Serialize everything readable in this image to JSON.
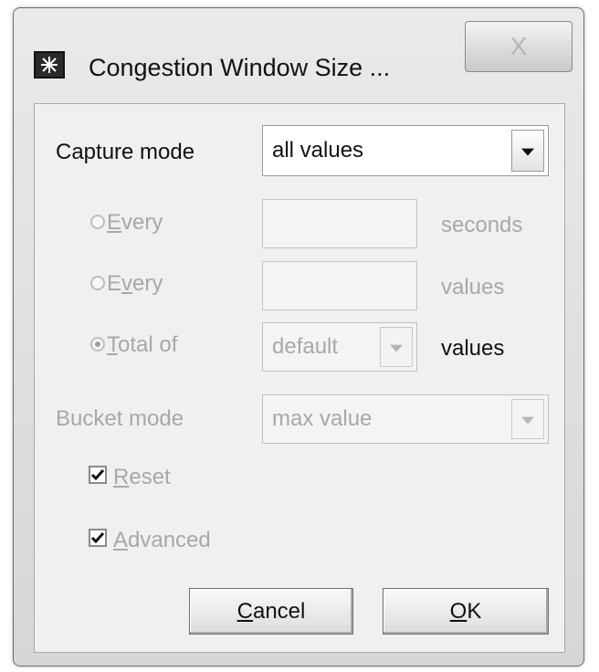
{
  "window": {
    "title": "Congestion Window Size ...",
    "close_glyph": "X",
    "icon": "app-icon"
  },
  "capture_mode": {
    "label": "Capture mode",
    "selected": "all values",
    "options_visible": [
      "all values"
    ]
  },
  "options": {
    "every_seconds": {
      "label_first": "E",
      "label_rest": "very",
      "value": "",
      "unit": "seconds",
      "checked": false,
      "enabled": false
    },
    "every_values": {
      "label_prefix": "E",
      "label_underline": "v",
      "label_rest": "ery",
      "value": "",
      "unit": "values",
      "checked": false,
      "enabled": false
    },
    "total_of": {
      "label_first": "T",
      "label_rest": "otal of",
      "selected": "default",
      "unit": "values",
      "checked": true,
      "enabled": false
    }
  },
  "bucket_mode": {
    "label": "Bucket mode",
    "selected": "max value",
    "enabled": false
  },
  "checkboxes": {
    "reset": {
      "label_first": "R",
      "label_rest": "eset",
      "checked": true,
      "enabled": false
    },
    "advanced": {
      "label_first": "A",
      "label_rest": "dvanced",
      "checked": true,
      "enabled": false
    }
  },
  "buttons": {
    "cancel": {
      "label_first": "C",
      "label_rest": "ancel"
    },
    "ok": {
      "label_first": "O",
      "label_rest": "K"
    }
  },
  "colors": {
    "disabled_text": "#a8a8a8",
    "enabled_text": "#111111",
    "client_background": "#f0f0f0"
  }
}
